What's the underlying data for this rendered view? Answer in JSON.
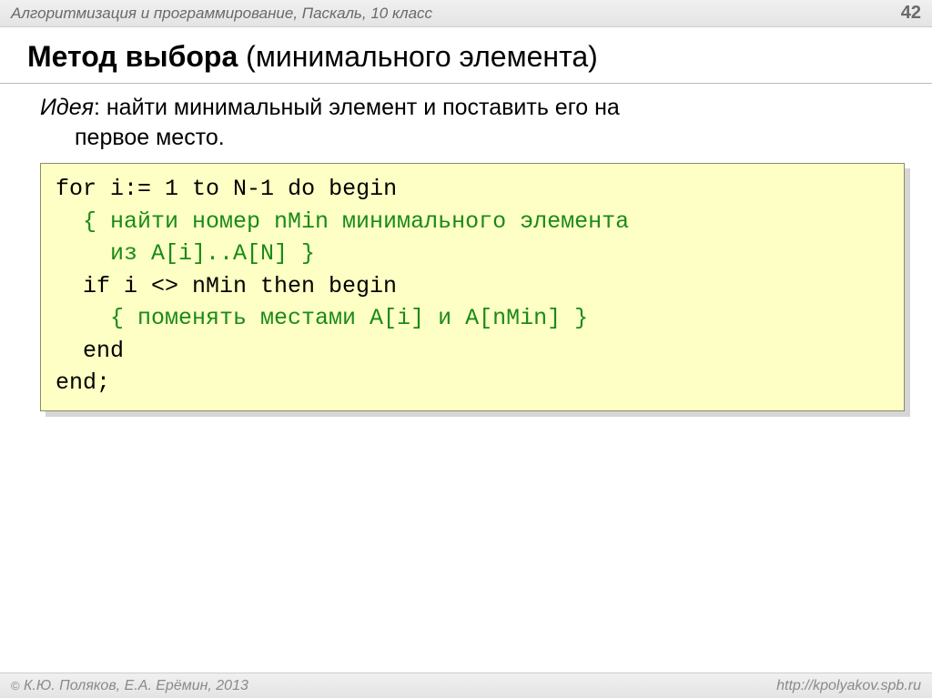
{
  "header": {
    "course": "Алгоритмизация и программирование, Паскаль, 10 класс",
    "page": "42"
  },
  "title": {
    "bold": "Метод выбора",
    "normal": " (минимального элемента)"
  },
  "idea": {
    "label": "Идея",
    "text1": ": найти минимальный элемент и поставить его на",
    "text2": "первое место."
  },
  "code": {
    "l1a": "for i:=",
    "l1_one": " 1 ",
    "l1b": "to N-1 do begin",
    "l2": "  { найти номер nMin минимального элемента",
    "l3": "    из A[i]..A[N] }",
    "l4": "  if i <> nMin then begin",
    "l5": "    { поменять местами A[i] и A[nMin] }",
    "l6": "  end",
    "l7": "end;"
  },
  "footer": {
    "copyright_symbol": "©",
    "authors": " К.Ю. Поляков, Е.А. Ерёмин, 2013",
    "url": "http://kpolyakov.spb.ru"
  }
}
